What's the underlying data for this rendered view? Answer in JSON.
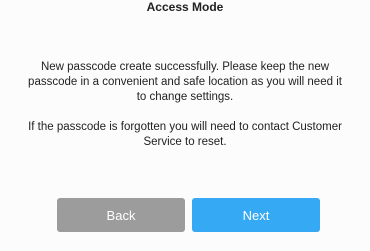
{
  "header": {
    "title": "Access Mode"
  },
  "message": {
    "paragraph_1": "New passcode create successfully. Please keep the new passcode in a convenient and safe location as you will need it to change settings.",
    "paragraph_2": "If the passcode is forgotten you will need to contact Customer Service to reset."
  },
  "buttons": {
    "back_label": "Back",
    "next_label": "Next"
  },
  "colors": {
    "back_button": "#9c9c9c",
    "next_button": "#36a9f4",
    "button_text": "#ffffff"
  }
}
